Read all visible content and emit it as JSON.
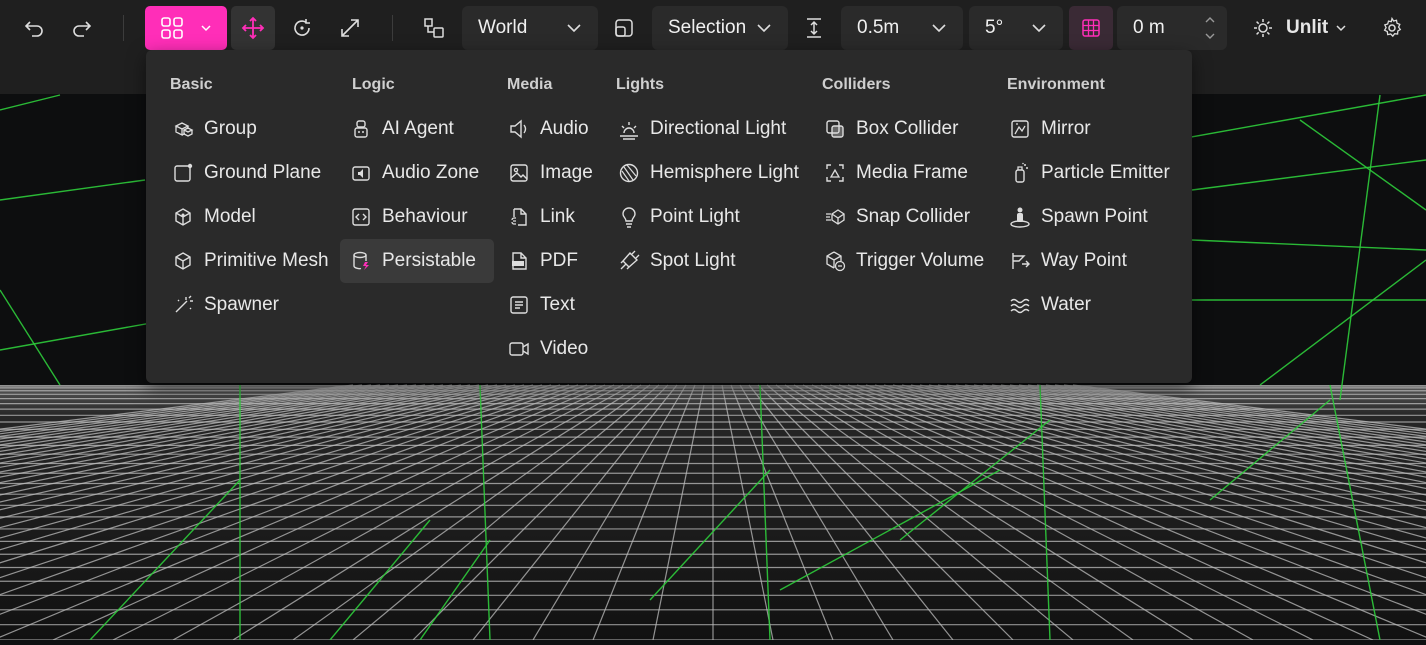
{
  "toolbar": {
    "space_label": "World",
    "pivot_label": "Selection",
    "translate_snap": "0.5m",
    "rotate_snap": "5°",
    "grid_height": "0 m",
    "render_mode": "Unlit"
  },
  "colors": {
    "accent": "#ff2eb8",
    "grid_green": "#2ecc3b"
  },
  "menu": {
    "columns": [
      {
        "title": "Basic",
        "items": [
          {
            "label": "Group",
            "icon": "group-icon"
          },
          {
            "label": "Ground Plane",
            "icon": "ground-plane-icon"
          },
          {
            "label": "Model",
            "icon": "model-icon"
          },
          {
            "label": "Primitive Mesh",
            "icon": "primitive-mesh-icon"
          },
          {
            "label": "Spawner",
            "icon": "spawner-icon"
          }
        ]
      },
      {
        "title": "Logic",
        "items": [
          {
            "label": "AI Agent",
            "icon": "ai-agent-icon"
          },
          {
            "label": "Audio Zone",
            "icon": "audio-zone-icon"
          },
          {
            "label": "Behaviour",
            "icon": "behaviour-icon"
          },
          {
            "label": "Persistable",
            "icon": "persistable-icon"
          }
        ]
      },
      {
        "title": "Media",
        "items": [
          {
            "label": "Audio",
            "icon": "audio-icon"
          },
          {
            "label": "Image",
            "icon": "image-icon"
          },
          {
            "label": "Link",
            "icon": "link-icon"
          },
          {
            "label": "PDF",
            "icon": "pdf-icon"
          },
          {
            "label": "Text",
            "icon": "text-icon"
          },
          {
            "label": "Video",
            "icon": "video-icon"
          }
        ]
      },
      {
        "title": "Lights",
        "items": [
          {
            "label": "Directional Light",
            "icon": "directional-light-icon"
          },
          {
            "label": "Hemisphere Light",
            "icon": "hemisphere-light-icon"
          },
          {
            "label": "Point Light",
            "icon": "point-light-icon"
          },
          {
            "label": "Spot Light",
            "icon": "spot-light-icon"
          }
        ]
      },
      {
        "title": "Colliders",
        "items": [
          {
            "label": "Box Collider",
            "icon": "box-collider-icon"
          },
          {
            "label": "Media Frame",
            "icon": "media-frame-icon"
          },
          {
            "label": "Snap Collider",
            "icon": "snap-collider-icon"
          },
          {
            "label": "Trigger Volume",
            "icon": "trigger-volume-icon"
          }
        ]
      },
      {
        "title": "Environment",
        "items": [
          {
            "label": "Mirror",
            "icon": "mirror-icon"
          },
          {
            "label": "Particle Emitter",
            "icon": "particle-emitter-icon"
          },
          {
            "label": "Spawn Point",
            "icon": "spawn-point-icon"
          },
          {
            "label": "Way Point",
            "icon": "way-point-icon"
          },
          {
            "label": "Water",
            "icon": "water-icon"
          }
        ]
      }
    ]
  }
}
